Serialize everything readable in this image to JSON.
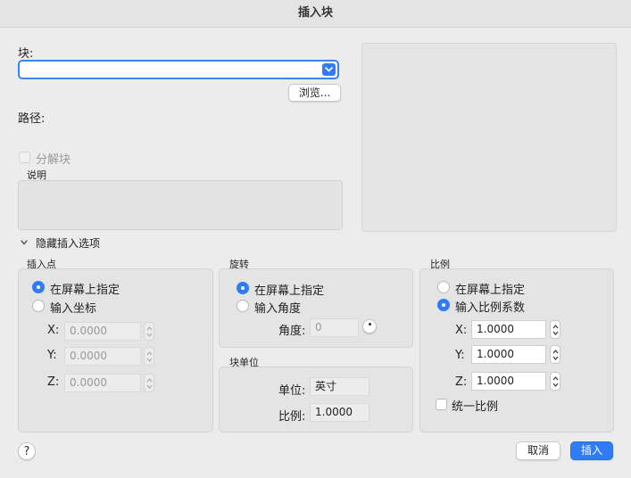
{
  "window": {
    "title": "插入块"
  },
  "block": {
    "label": "块:",
    "value": "",
    "browse_label": "浏览...",
    "path_label": "路径:",
    "explode_label": "分解块",
    "description_label": "说明"
  },
  "options": {
    "toggle_label": "隐藏插入选项"
  },
  "insertion_point": {
    "title": "插入点",
    "specify_on_screen": "在屏幕上指定",
    "enter_coords": "输入坐标",
    "x_label": "X:",
    "x_value": "0.0000",
    "y_label": "Y:",
    "y_value": "0.0000",
    "z_label": "Z:",
    "z_value": "0.0000"
  },
  "rotation": {
    "title": "旋转",
    "specify_on_screen": "在屏幕上指定",
    "enter_angle": "输入角度",
    "angle_label": "角度:",
    "angle_value": "0"
  },
  "block_unit": {
    "title": "块单位",
    "unit_label": "单位:",
    "unit_value": "英寸",
    "scale_label": "比例:",
    "scale_value": "1.0000"
  },
  "scale": {
    "title": "比例",
    "specify_on_screen": "在屏幕上指定",
    "enter_factors": "输入比例系数",
    "x_label": "X:",
    "x_value": "1.0000",
    "y_label": "Y:",
    "y_value": "1.0000",
    "z_label": "Z:",
    "z_value": "1.0000",
    "uniform_label": "统一比例"
  },
  "footer": {
    "help_label": "?",
    "cancel_label": "取消",
    "insert_label": "插入"
  },
  "colors": {
    "accent": "#2f7cf6"
  }
}
